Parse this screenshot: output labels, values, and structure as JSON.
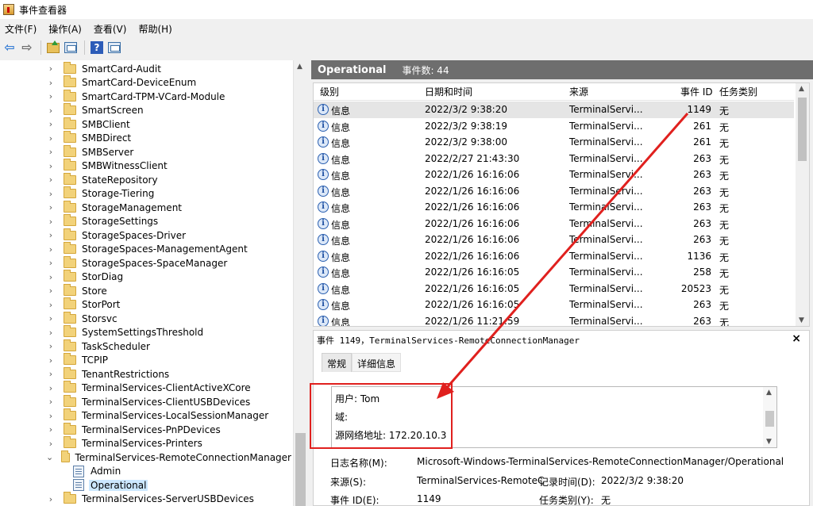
{
  "window": {
    "title": "事件查看器"
  },
  "menu": [
    "文件(F)",
    "操作(A)",
    "查看(V)",
    "帮助(H)"
  ],
  "toolbar": {
    "icons": [
      "back-icon",
      "forward-icon",
      "folder-up-icon",
      "show-hide-pane-icon",
      "help-icon",
      "properties-pane-icon"
    ]
  },
  "tree": {
    "items": [
      {
        "label": "SmartCard-Audit",
        "expanded": false
      },
      {
        "label": "SmartCard-DeviceEnum",
        "expanded": false
      },
      {
        "label": "SmartCard-TPM-VCard-Module",
        "expanded": false
      },
      {
        "label": "SmartScreen",
        "expanded": false
      },
      {
        "label": "SMBClient",
        "expanded": false
      },
      {
        "label": "SMBDirect",
        "expanded": false
      },
      {
        "label": "SMBServer",
        "expanded": false
      },
      {
        "label": "SMBWitnessClient",
        "expanded": false
      },
      {
        "label": "StateRepository",
        "expanded": false
      },
      {
        "label": "Storage-Tiering",
        "expanded": false
      },
      {
        "label": "StorageManagement",
        "expanded": false
      },
      {
        "label": "StorageSettings",
        "expanded": false
      },
      {
        "label": "StorageSpaces-Driver",
        "expanded": false
      },
      {
        "label": "StorageSpaces-ManagementAgent",
        "expanded": false
      },
      {
        "label": "StorageSpaces-SpaceManager",
        "expanded": false
      },
      {
        "label": "StorDiag",
        "expanded": false
      },
      {
        "label": "Store",
        "expanded": false
      },
      {
        "label": "StorPort",
        "expanded": false
      },
      {
        "label": "Storsvc",
        "expanded": false
      },
      {
        "label": "SystemSettingsThreshold",
        "expanded": false
      },
      {
        "label": "TaskScheduler",
        "expanded": false
      },
      {
        "label": "TCPIP",
        "expanded": false
      },
      {
        "label": "TenantRestrictions",
        "expanded": false
      },
      {
        "label": "TerminalServices-ClientActiveXCore",
        "expanded": false
      },
      {
        "label": "TerminalServices-ClientUSBDevices",
        "expanded": false
      },
      {
        "label": "TerminalServices-LocalSessionManager",
        "expanded": false
      },
      {
        "label": "TerminalServices-PnPDevices",
        "expanded": false
      },
      {
        "label": "TerminalServices-Printers",
        "expanded": false
      },
      {
        "label": "TerminalServices-RemoteConnectionManager",
        "expanded": true
      },
      {
        "label": "Admin",
        "leaf": true
      },
      {
        "label": "Operational",
        "leaf": true,
        "selected": true
      },
      {
        "label": "TerminalServices-ServerUSBDevices",
        "expanded": false
      }
    ]
  },
  "log_header": {
    "title": "Operational",
    "count": "事件数: 44"
  },
  "columns": {
    "level": "级别",
    "date": "日期和时间",
    "source": "来源",
    "event_id": "事件 ID",
    "category": "任务类别"
  },
  "events": [
    {
      "level": "信息",
      "date": "2022/3/2 9:38:20",
      "source": "TerminalServi...",
      "id": "1149",
      "cat": "无"
    },
    {
      "level": "信息",
      "date": "2022/3/2 9:38:19",
      "source": "TerminalServi...",
      "id": "261",
      "cat": "无"
    },
    {
      "level": "信息",
      "date": "2022/3/2 9:38:00",
      "source": "TerminalServi...",
      "id": "261",
      "cat": "无"
    },
    {
      "level": "信息",
      "date": "2022/2/27 21:43:30",
      "source": "TerminalServi...",
      "id": "263",
      "cat": "无"
    },
    {
      "level": "信息",
      "date": "2022/1/26 16:16:06",
      "source": "TerminalServi...",
      "id": "263",
      "cat": "无"
    },
    {
      "level": "信息",
      "date": "2022/1/26 16:16:06",
      "source": "TerminalServi...",
      "id": "263",
      "cat": "无"
    },
    {
      "level": "信息",
      "date": "2022/1/26 16:16:06",
      "source": "TerminalServi...",
      "id": "263",
      "cat": "无"
    },
    {
      "level": "信息",
      "date": "2022/1/26 16:16:06",
      "source": "TerminalServi...",
      "id": "263",
      "cat": "无"
    },
    {
      "level": "信息",
      "date": "2022/1/26 16:16:06",
      "source": "TerminalServi...",
      "id": "263",
      "cat": "无"
    },
    {
      "level": "信息",
      "date": "2022/1/26 16:16:06",
      "source": "TerminalServi...",
      "id": "1136",
      "cat": "无"
    },
    {
      "level": "信息",
      "date": "2022/1/26 16:16:05",
      "source": "TerminalServi...",
      "id": "258",
      "cat": "无"
    },
    {
      "level": "信息",
      "date": "2022/1/26 16:16:05",
      "source": "TerminalServi...",
      "id": "20523",
      "cat": "无"
    },
    {
      "level": "信息",
      "date": "2022/1/26 16:16:05",
      "source": "TerminalServi...",
      "id": "263",
      "cat": "无"
    },
    {
      "level": "信息",
      "date": "2022/1/26 11:21:59",
      "source": "TerminalServi...",
      "id": "263",
      "cat": "无"
    }
  ],
  "detail": {
    "title": "事件 1149，TerminalServices-RemoteConnectionManager",
    "close": "×",
    "tab_general": "常规",
    "tab_details": "详细信息",
    "desc_user": "用户: Tom",
    "desc_domain": "域:",
    "desc_addr": "源网络地址: 172.20.10.3",
    "log_name_label": "日志名称(M):",
    "log_name_value": "Microsoft-Windows-TerminalServices-RemoteConnectionManager/Operational",
    "source_label": "来源(S):",
    "source_value": "TerminalServices-RemoteC",
    "logged_label": "记录时间(D):",
    "logged_value": "2022/3/2 9:38:20",
    "event_id_label": "事件 ID(E):",
    "event_id_value": "1149",
    "task_label": "任务类别(Y):",
    "task_value": "无"
  },
  "annotation": {
    "color": "#e0201e"
  }
}
